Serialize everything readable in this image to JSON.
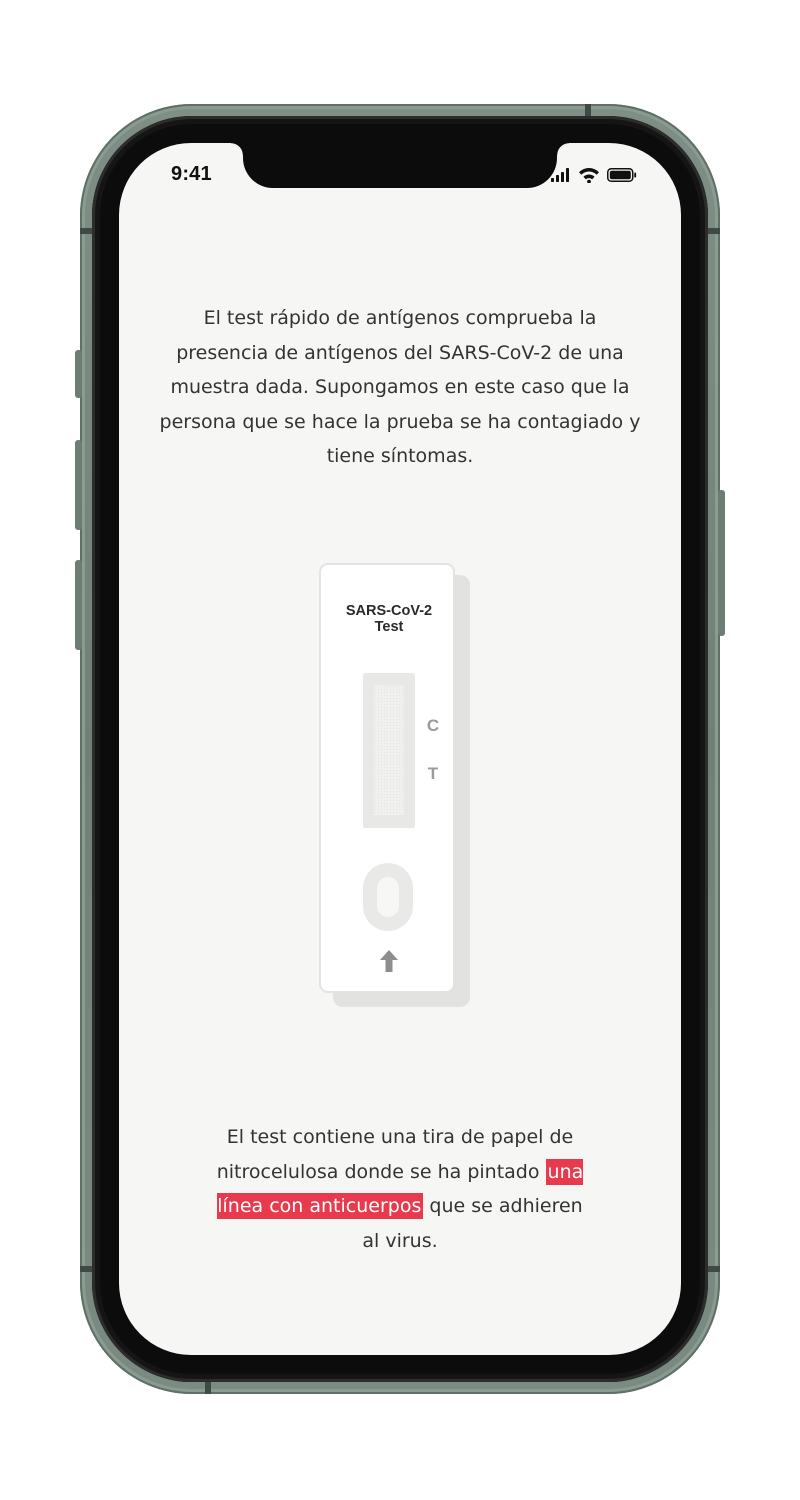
{
  "status_bar": {
    "time": "9:41",
    "icons": [
      "signal-icon",
      "wifi-icon",
      "battery-icon"
    ]
  },
  "intro_text": "El test rápido de antígenos comprueba la presencia de antígenos del SARS-CoV-2 de una muestra dada. Supongamos en este caso que la persona que se hace la prueba se ha contagiado y tiene síntomas.",
  "test_cassette": {
    "title_line1": "SARS-CoV-2",
    "title_line2": "Test",
    "control_label": "C",
    "test_label": "T",
    "sample_arrow_icon": "arrow-up-icon"
  },
  "explanation": {
    "before": "El test contiene una tira de papel de nitrocelulosa donde se ha pintado",
    "highlight": "una línea con anticuerpos",
    "after": "que se adhieren al virus."
  },
  "colors": {
    "highlight": "#e8394d",
    "screen_background": "#f6f6f4",
    "phone_frame": "#7a8b81"
  }
}
